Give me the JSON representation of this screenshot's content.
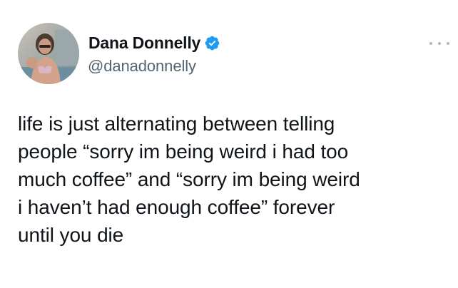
{
  "author": {
    "display_name": "Dana Donnelly",
    "handle": "@danadonnelly",
    "verified": true
  },
  "tweet": {
    "lines": [
      "life is just alternating between telling",
      "people “sorry im being weird i had too",
      "much coffee” and “sorry im being weird",
      "i haven’t had enough coffee” forever",
      "until you die"
    ]
  },
  "icons": {
    "verified": "verified-badge-icon",
    "more": "more-options-icon"
  },
  "colors": {
    "text": "#0f1419",
    "secondary_text": "#536471",
    "verified_blue": "#1d9bf0",
    "background": "#ffffff"
  }
}
